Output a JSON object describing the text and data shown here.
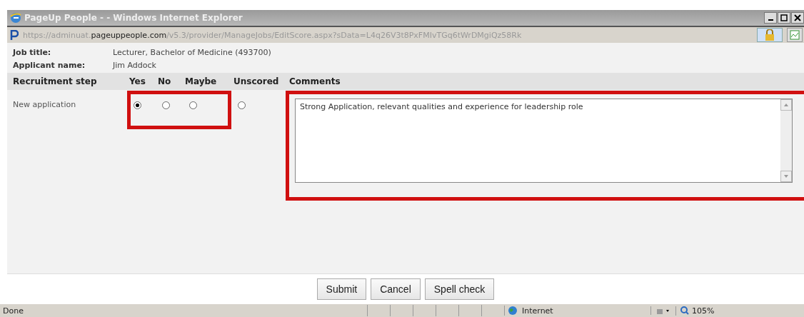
{
  "window": {
    "title": "PageUp People - - Windows Internet Explorer"
  },
  "address": {
    "scheme": "https://",
    "host_prefix": "adminuat.",
    "host": "pageuppeople.com",
    "path": "/v5.3/provider/ManageJobs/EditScore.aspx?sData=L4q26V3t8PxFMIvTGq6tWrDMgiQz58Rk"
  },
  "details": [
    {
      "label": "Job title:",
      "value": "Lecturer, Bachelor of Medicine (493700)"
    },
    {
      "label": "Applicant name:",
      "value": "Jim Addock"
    }
  ],
  "table": {
    "columns": [
      "Recruitment step",
      "Yes",
      "No",
      "Maybe",
      "Unscored",
      "Comments"
    ],
    "rows": [
      {
        "step": "New application",
        "options": [
          {
            "selected": true
          },
          {
            "selected": false
          },
          {
            "selected": false
          },
          {
            "selected": false
          }
        ],
        "comment": "Strong Application, relevant qualities and experience for leadership role"
      }
    ]
  },
  "buttons": [
    "Submit",
    "Cancel",
    "Spell check"
  ],
  "status_bar": {
    "text": "Done",
    "zone": "Internet",
    "zoom": "105%"
  }
}
